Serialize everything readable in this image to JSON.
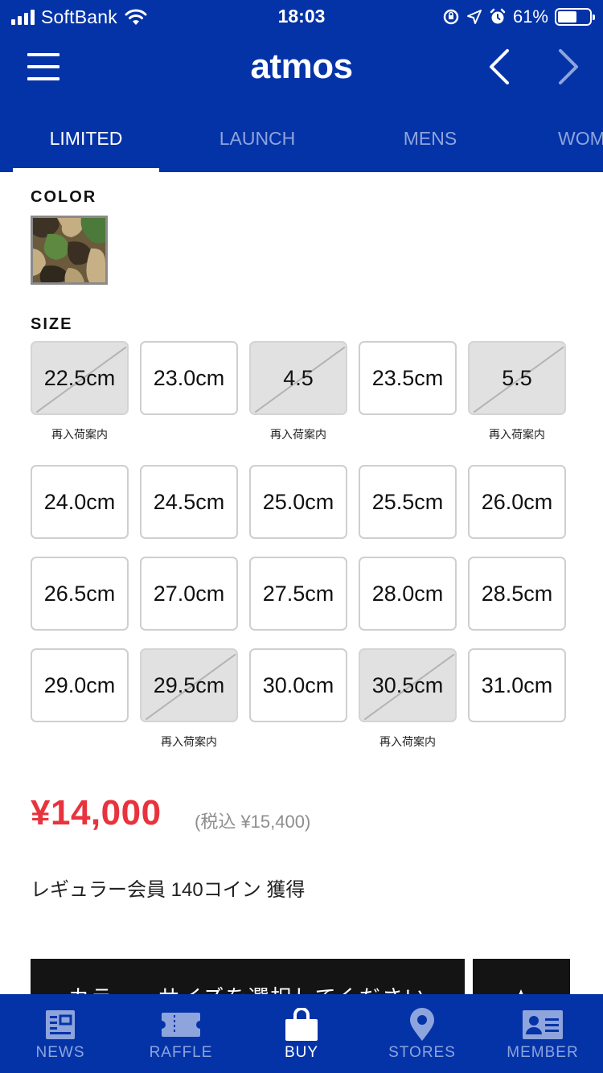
{
  "status_bar": {
    "carrier": "SoftBank",
    "time": "18:03",
    "battery": "61%",
    "battery_level": 0.61
  },
  "header": {
    "logo": "atmos"
  },
  "tabs": [
    {
      "label": "LIMITED",
      "active": true
    },
    {
      "label": "LAUNCH",
      "active": false
    },
    {
      "label": "MENS",
      "active": false
    },
    {
      "label": "WOM",
      "active": false
    }
  ],
  "color_section": {
    "label": "COLOR"
  },
  "size_section": {
    "label": "SIZE",
    "restock_label": "再入荷案内",
    "rows": [
      [
        {
          "label": "22.5cm",
          "available": false
        },
        {
          "label": "23.0cm",
          "available": true
        },
        {
          "label": "4.5",
          "available": false
        },
        {
          "label": "23.5cm",
          "available": true
        },
        {
          "label": "5.5",
          "available": false
        }
      ],
      [
        {
          "label": "24.0cm",
          "available": true
        },
        {
          "label": "24.5cm",
          "available": true
        },
        {
          "label": "25.0cm",
          "available": true
        },
        {
          "label": "25.5cm",
          "available": true
        },
        {
          "label": "26.0cm",
          "available": true
        }
      ],
      [
        {
          "label": "26.5cm",
          "available": true
        },
        {
          "label": "27.0cm",
          "available": true
        },
        {
          "label": "27.5cm",
          "available": true
        },
        {
          "label": "28.0cm",
          "available": true
        },
        {
          "label": "28.5cm",
          "available": true
        }
      ],
      [
        {
          "label": "29.0cm",
          "available": true
        },
        {
          "label": "29.5cm",
          "available": false
        },
        {
          "label": "30.0cm",
          "available": true
        },
        {
          "label": "30.5cm",
          "available": false
        },
        {
          "label": "31.0cm",
          "available": true
        }
      ]
    ]
  },
  "price": {
    "amount": "¥14,000",
    "tax_included": "(税込 ¥15,400)"
  },
  "coins_text": "レギュラー会員 140コイン 獲得",
  "cta": {
    "label": "カラー・サイズを選択してください"
  },
  "bottom_nav": [
    {
      "label": "NEWS",
      "icon": "news-icon",
      "active": false
    },
    {
      "label": "RAFFLE",
      "icon": "ticket-icon",
      "active": false
    },
    {
      "label": "BUY",
      "icon": "shopping-bag-icon",
      "active": true
    },
    {
      "label": "STORES",
      "icon": "map-pin-icon",
      "active": false
    },
    {
      "label": "MEMBER",
      "icon": "member-card-icon",
      "active": false
    }
  ],
  "colors": {
    "brand_blue": "#0433a8",
    "inactive_tab": "#8ea4dc",
    "price_red": "#e8333e",
    "button_dark": "#141414"
  }
}
